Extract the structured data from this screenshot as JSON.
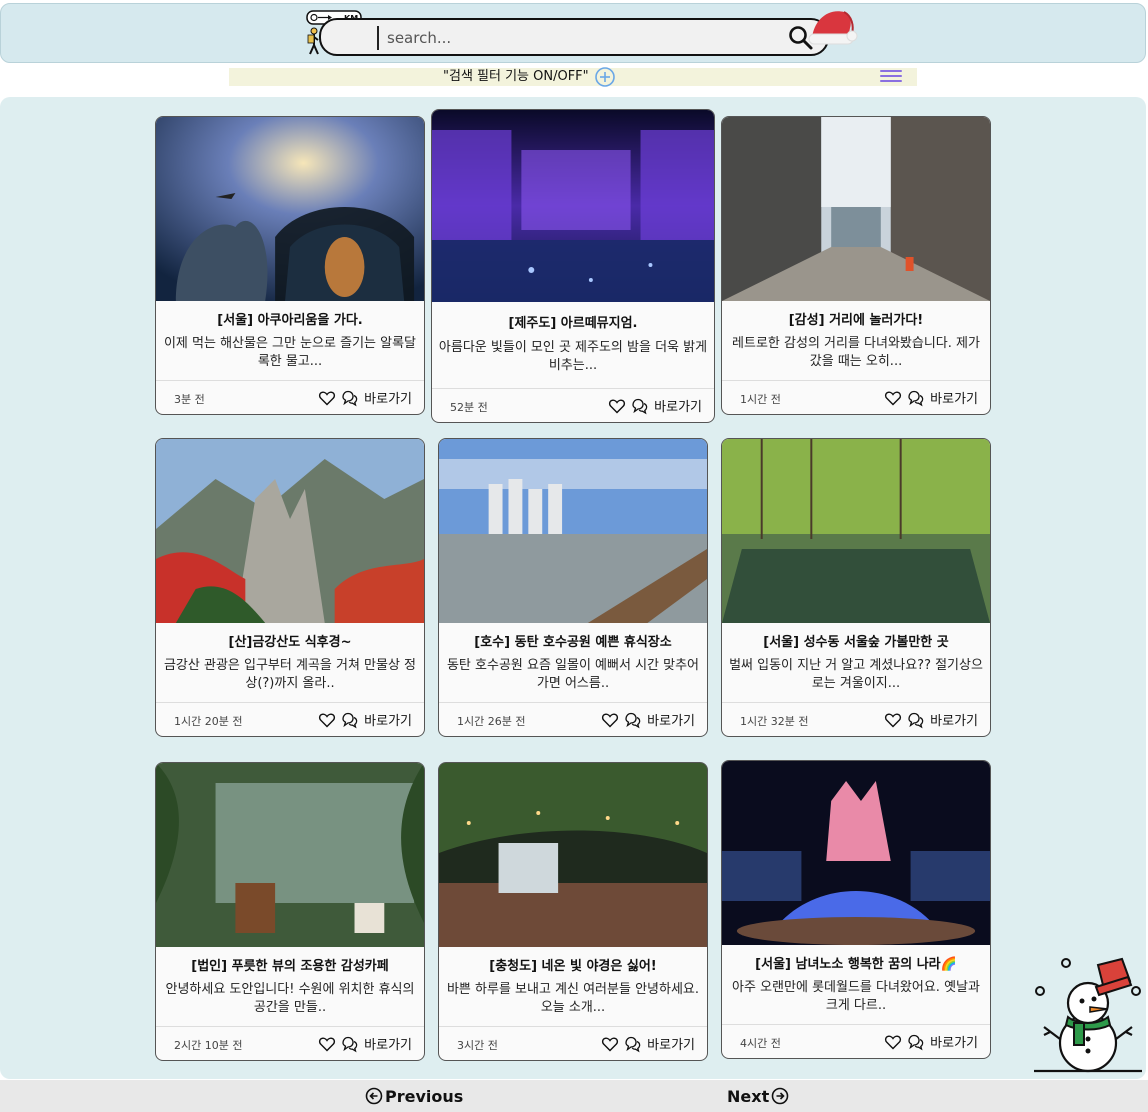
{
  "header": {
    "logo_text": "KM",
    "search": {
      "placeholder": "search...",
      "value": ""
    }
  },
  "filterbar": {
    "label": "\"검색 필터 기능 ON/OFF\""
  },
  "cards": [
    {
      "title": "[서울] 아쿠아리움을 가다.",
      "desc": "이제 먹는 해산물은 그만 눈으로 즐기는 알록달록한 물고...",
      "time": "3분 전",
      "link": "바로가기"
    },
    {
      "title": "[제주도] 아르떼뮤지엄.",
      "desc": "아름다운 빛들이 모인 곳 제주도의 밤을 더욱 밝게 비추는...",
      "time": "52분 전",
      "link": "바로가기"
    },
    {
      "title": "[감성] 거리에 놀러가다!",
      "desc": "레트로한 감성의 거리를 다녀와봤습니다. 제가 갔을 때는 오히...",
      "time": "1시간 전",
      "link": "바로가기"
    },
    {
      "title": "[산]금강산도 식후경~",
      "desc": "금강산 관광은 입구부터 계곡을 거쳐 만물상 정상(?)까지 올라..",
      "time": "1시간 20분 전",
      "link": "바로가기"
    },
    {
      "title": "[호수] 동탄 호수공원 예쁜 휴식장소",
      "desc": "동탄 호수공원 요즘 일몰이 예뻐서 시간 맞추어가면 어스름..",
      "time": "1시간 26분 전",
      "link": "바로가기"
    },
    {
      "title": "[서울] 성수동 서울숲 가볼만한 곳",
      "desc": "벌써 입동이 지난 거 알고 계셨나요?? 절기상으로는 겨울이지...",
      "time": "1시간 32분 전",
      "link": "바로가기"
    },
    {
      "title": "[법인] 푸릇한 뷰의 조용한 감성카페",
      "desc": "안녕하세요 도안입니다! 수원에 위치한 휴식의 공간을 만들..",
      "time": "2시간 10분 전",
      "link": "바로가기"
    },
    {
      "title": "[충청도] 네온 빛 야경은 싫어!",
      "desc": "바쁜 하루를 보내고 계신 여러분들 안녕하세요. 오늘 소개...",
      "time": "3시간 전",
      "link": "바로가기"
    },
    {
      "title": "[서울] 남녀노소 행복한 꿈의 나라🌈",
      "desc": "아주 오랜만에 롯데월드를 다녀왔어요. 옛날과 크게 다르..",
      "time": "4시간 전",
      "link": "바로가기"
    }
  ],
  "pager": {
    "previous": "Previous",
    "next": "Next"
  },
  "icons": {
    "search": "search-icon",
    "filter": "plus-circle-icon",
    "menu": "hamburger-menu-icon",
    "like": "heart-icon",
    "comment": "comment-icon",
    "santa": "santa-hat-icon",
    "snowman": "snowman-icon"
  },
  "colors": {
    "header_bg": "#d6e9ee",
    "panel_bg": "#deeef0",
    "filter_bg": "#f3f3dc",
    "accent_purple": "#8a6fe0",
    "toggle_blue": "#6aa7e6"
  }
}
